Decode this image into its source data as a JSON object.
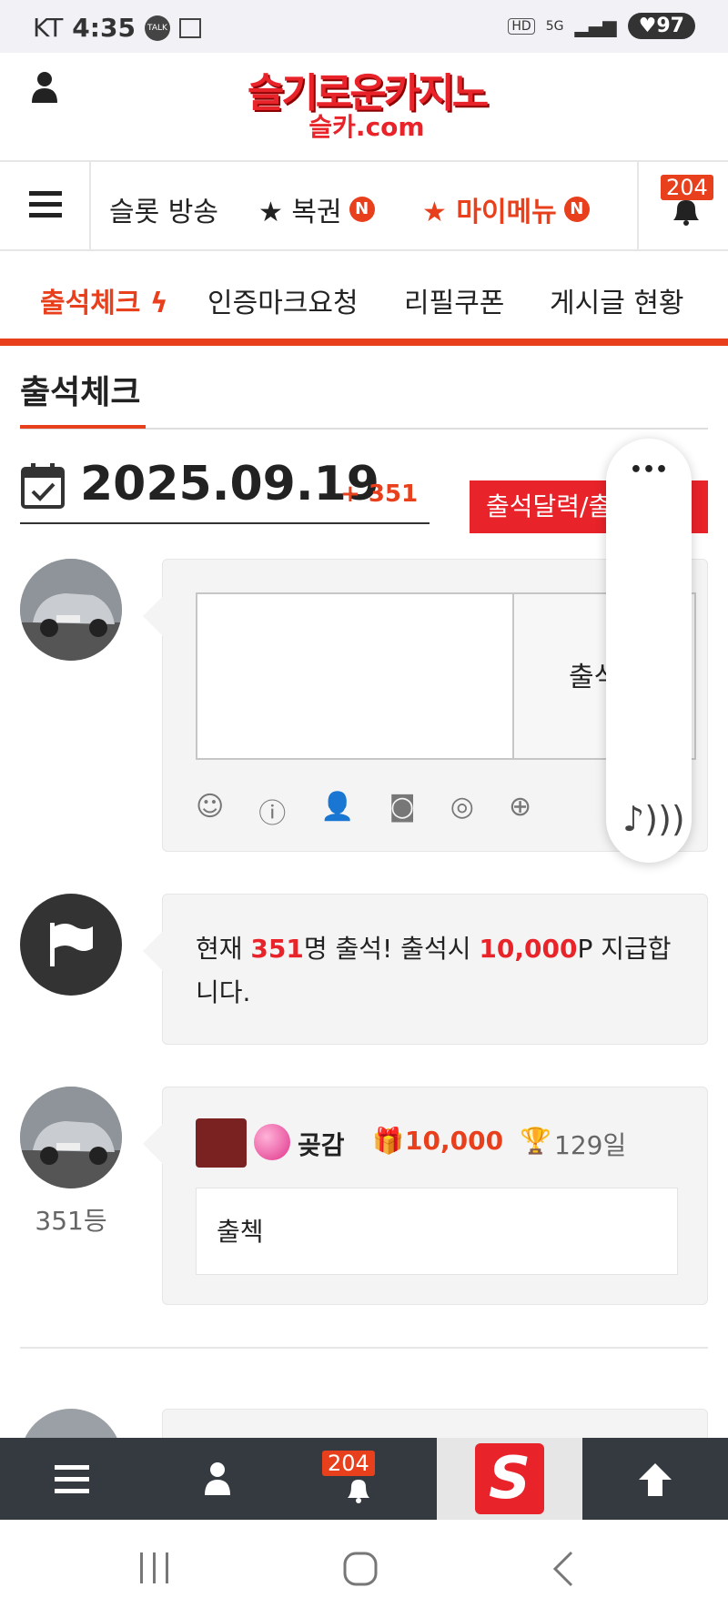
{
  "status": {
    "carrier": "KT",
    "time": "4:35",
    "talk": "TALK",
    "battery": "97",
    "hd": "HD",
    "net": "5G"
  },
  "header": {
    "logo": "슬기로운카지노",
    "logo_sub": "슬카.com"
  },
  "nav": {
    "item1": "슬롯 방송",
    "item2": "★ 복권",
    "item3": "★ 마이메뉴",
    "new_badge": "N",
    "notif_count": "204"
  },
  "tabs": [
    "출석체크",
    "인증마크요청",
    "리필쿠폰",
    "게시글 현황"
  ],
  "section_title": "출석체크",
  "date": {
    "value": "2025.09.19",
    "delta": "+ 351",
    "calendar_button": "출석달력/출"
  },
  "comment_box": {
    "submit_label": "출석"
  },
  "notice": {
    "p1": "현재 ",
    "count": "351",
    "p2": "명 출석! 출석시 ",
    "points": "10,000",
    "p3": "P 지급합니다."
  },
  "entry": {
    "rank": "351등",
    "name": "곶감",
    "points": "10,000",
    "days": "129일",
    "message": "출첵"
  },
  "float_menu": {
    "more": "•••"
  },
  "bottombar": {
    "notif_count": "204"
  },
  "colors": {
    "accent": "#e8401c",
    "red": "#e8232a",
    "dark": "#343a40"
  }
}
